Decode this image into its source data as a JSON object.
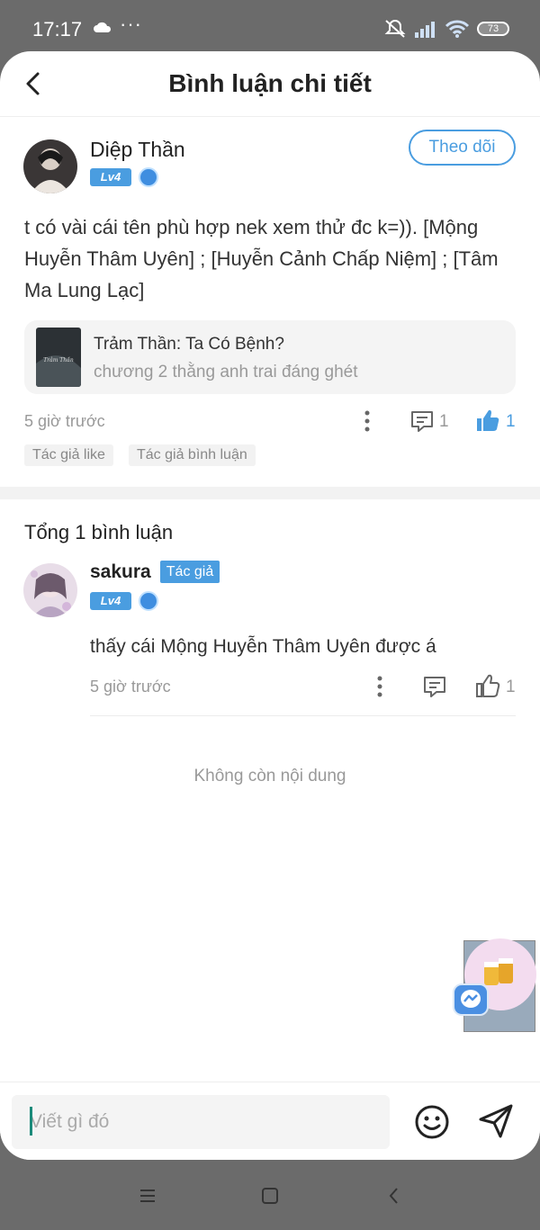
{
  "status_bar": {
    "time": "17:17",
    "dots": "···",
    "battery": "73"
  },
  "header": {
    "title": "Bình luận chi tiết"
  },
  "post": {
    "author": "Diệp Thần",
    "level": "Lv4",
    "follow_label": "Theo dõi",
    "text": "t có vài cái tên phù hợp nek xem thử đc k=)). [Mộng Huyễn Thâm Uyên] ; [Huyễn Cảnh Chấp Niệm] ; [Tâm Ma Lung Lạc]",
    "book": {
      "title": "Trảm Thần: Ta Có Bệnh?",
      "chapter": "chương 2 thằng anh trai đáng ghét",
      "cover_text": "Trảm Thần"
    },
    "time": "5 giờ trước",
    "comment_count": "1",
    "like_count": "1",
    "tags": [
      "Tác giả like",
      "Tác giả bình luận"
    ]
  },
  "comments": {
    "total_label": "Tổng 1 bình luận",
    "items": [
      {
        "author": "sakura",
        "author_tag": "Tác giả",
        "level": "Lv4",
        "text": "thấy cái Mộng Huyễn Thâm Uyên được á",
        "time": "5 giờ trước",
        "like_count": "1"
      }
    ],
    "end_label": "Không còn nội dung"
  },
  "input": {
    "placeholder": "Viết gì đó"
  },
  "colors": {
    "accent": "#4a9de0",
    "muted": "#999999",
    "chrome": "#6b6b6b"
  },
  "icons": [
    "back-arrow-icon",
    "more-dots-icon",
    "comment-icon",
    "thumbs-up-icon",
    "emoji-icon",
    "send-icon",
    "messenger-icon"
  ]
}
